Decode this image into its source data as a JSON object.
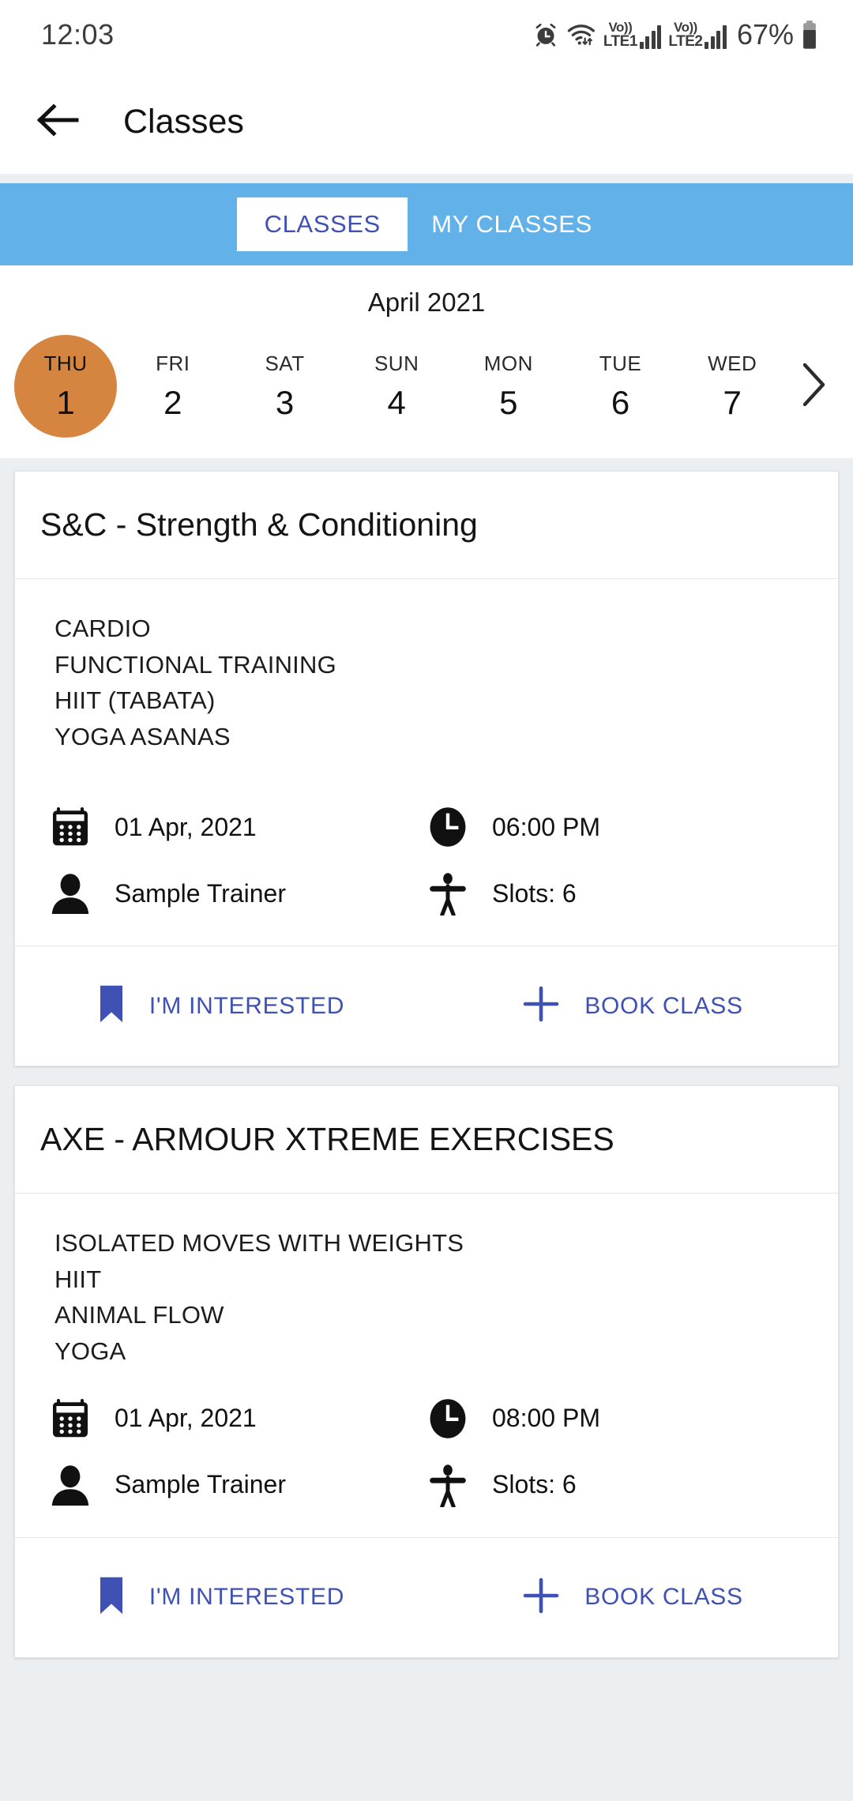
{
  "status_bar": {
    "time": "12:03",
    "battery_percent": "67%",
    "icons": [
      "alarm-icon",
      "wifi-icon",
      "volte-lte1-icon",
      "signal-bars-1-icon",
      "volte-lte2-icon",
      "signal-bars-2-icon",
      "battery-icon"
    ],
    "sim1_label_top": "Vo))",
    "sim1_label_bottom": "LTE1",
    "sim2_label_top": "Vo))",
    "sim2_label_bottom": "LTE2"
  },
  "app_bar": {
    "back_icon": "arrow-left-icon",
    "title": "Classes"
  },
  "tabs": {
    "active_index": 0,
    "items": [
      {
        "label": "CLASSES",
        "active": true
      },
      {
        "label": "MY CLASSES",
        "active": false
      }
    ],
    "bar_color": "#62b1e8",
    "active_text_color": "#3f51b5"
  },
  "date_picker": {
    "month": "April 2021",
    "selected_color": "#d5853f",
    "next_icon": "chevron-right-icon",
    "days": [
      {
        "weekday": "THU",
        "date": "1",
        "selected": true
      },
      {
        "weekday": "FRI",
        "date": "2",
        "selected": false
      },
      {
        "weekday": "SAT",
        "date": "3",
        "selected": false
      },
      {
        "weekday": "SUN",
        "date": "4",
        "selected": false
      },
      {
        "weekday": "MON",
        "date": "5",
        "selected": false
      },
      {
        "weekday": "TUE",
        "date": "6",
        "selected": false
      },
      {
        "weekday": "WED",
        "date": "7",
        "selected": false
      }
    ]
  },
  "classes": [
    {
      "title": "S&C - Strength & Conditioning",
      "description": [
        "CARDIO",
        "FUNCTIONAL TRAINING",
        "HIIT (TABATA)",
        "YOGA ASANAS"
      ],
      "date": "01 Apr, 2021",
      "time": "06:00 PM",
      "trainer": "Sample Trainer",
      "slots": "Slots: 6",
      "actions": [
        {
          "label": "I'M INTERESTED",
          "icon": "bookmark-icon"
        },
        {
          "label": "BOOK CLASS",
          "icon": "plus-icon"
        }
      ]
    },
    {
      "title": "AXE - ARMOUR XTREME EXERCISES",
      "description": [
        "ISOLATED MOVES WITH WEIGHTS",
        "HIIT",
        "ANIMAL FLOW",
        "YOGA"
      ],
      "date": "01 Apr, 2021",
      "time": "08:00 PM",
      "trainer": "Sample Trainer",
      "slots": "Slots: 6",
      "actions": [
        {
          "label": "I'M INTERESTED",
          "icon": "bookmark-icon"
        },
        {
          "label": "BOOK CLASS",
          "icon": "plus-icon"
        }
      ]
    }
  ],
  "meta_icons": {
    "date": "calendar-icon",
    "time": "clock-icon",
    "trainer": "person-icon",
    "slots": "standing-figure-icon"
  }
}
